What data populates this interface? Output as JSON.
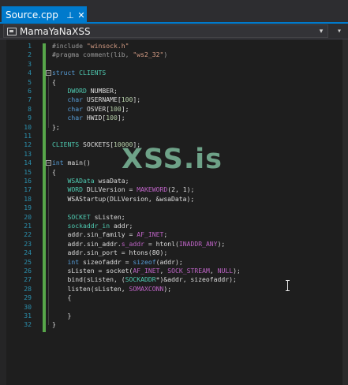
{
  "tab": {
    "title": "Source.cpp",
    "pin": "⊥",
    "close": "✕"
  },
  "nav": {
    "project": "MamaYaNaXSS",
    "dropdown": "▾",
    "split": "▾"
  },
  "watermark": "XSS.is",
  "lines": [
    {
      "n": "1",
      "tokens": [
        [
          "p",
          "#include "
        ],
        [
          "s",
          "\"winsock.h\""
        ]
      ]
    },
    {
      "n": "2",
      "tokens": [
        [
          "p",
          "#pragma comment(lib, "
        ],
        [
          "s",
          "\"ws2_32\""
        ],
        [
          "p",
          ")"
        ]
      ]
    },
    {
      "n": "3",
      "tokens": []
    },
    {
      "n": "4",
      "fold": true,
      "tokens": [
        [
          "k",
          "struct "
        ],
        [
          "t",
          "CLIENTS"
        ]
      ]
    },
    {
      "n": "5",
      "tokens": [
        [
          "d",
          "{"
        ]
      ]
    },
    {
      "n": "6",
      "tokens": [
        [
          "d",
          "    "
        ],
        [
          "t",
          "DWORD"
        ],
        [
          "d",
          " NUMBER;"
        ]
      ]
    },
    {
      "n": "7",
      "tokens": [
        [
          "d",
          "    "
        ],
        [
          "k",
          "char"
        ],
        [
          "d",
          " USERNAME["
        ],
        [
          "n",
          "100"
        ],
        [
          "d",
          "];"
        ]
      ]
    },
    {
      "n": "8",
      "tokens": [
        [
          "d",
          "    "
        ],
        [
          "k",
          "char"
        ],
        [
          "d",
          " OSVER["
        ],
        [
          "n",
          "100"
        ],
        [
          "d",
          "];"
        ]
      ]
    },
    {
      "n": "9",
      "tokens": [
        [
          "d",
          "    "
        ],
        [
          "k",
          "char"
        ],
        [
          "d",
          " HWID["
        ],
        [
          "n",
          "100"
        ],
        [
          "d",
          "];"
        ]
      ]
    },
    {
      "n": "10",
      "tokens": [
        [
          "d",
          "};"
        ]
      ]
    },
    {
      "n": "11",
      "tokens": []
    },
    {
      "n": "12",
      "tokens": [
        [
          "t",
          "CLIENTS"
        ],
        [
          "d",
          " SOCKETS["
        ],
        [
          "n",
          "10000"
        ],
        [
          "d",
          "];"
        ]
      ]
    },
    {
      "n": "13",
      "tokens": []
    },
    {
      "n": "14",
      "fold": true,
      "tokens": [
        [
          "k",
          "int"
        ],
        [
          "d",
          " main()"
        ]
      ]
    },
    {
      "n": "15",
      "tokens": [
        [
          "d",
          "{"
        ]
      ]
    },
    {
      "n": "16",
      "tokens": [
        [
          "d",
          "    "
        ],
        [
          "t",
          "WSAData"
        ],
        [
          "d",
          " wsaData;"
        ]
      ]
    },
    {
      "n": "17",
      "tokens": [
        [
          "d",
          "    "
        ],
        [
          "t",
          "WORD"
        ],
        [
          "d",
          " DLLVersion = "
        ],
        [
          "m",
          "MAKEWORD"
        ],
        [
          "d",
          "(2, 1);"
        ]
      ]
    },
    {
      "n": "18",
      "tokens": [
        [
          "d",
          "    WSAStartup(DLLVersion, &wsaData);"
        ]
      ]
    },
    {
      "n": "19",
      "tokens": []
    },
    {
      "n": "20",
      "tokens": [
        [
          "d",
          "    "
        ],
        [
          "t",
          "SOCKET"
        ],
        [
          "d",
          " sListen;"
        ]
      ]
    },
    {
      "n": "21",
      "tokens": [
        [
          "d",
          "    "
        ],
        [
          "t",
          "sockaddr_in"
        ],
        [
          "d",
          " addr;"
        ]
      ]
    },
    {
      "n": "22",
      "tokens": [
        [
          "d",
          "    addr.sin_family = "
        ],
        [
          "m",
          "AF_INET"
        ],
        [
          "d",
          ";"
        ]
      ]
    },
    {
      "n": "23",
      "tokens": [
        [
          "d",
          "    addr.sin_addr."
        ],
        [
          "m",
          "s_addr"
        ],
        [
          "d",
          " = htonl("
        ],
        [
          "m",
          "INADDR_ANY"
        ],
        [
          "d",
          ");"
        ]
      ]
    },
    {
      "n": "24",
      "tokens": [
        [
          "d",
          "    addr.sin_port = htons(80);"
        ]
      ]
    },
    {
      "n": "25",
      "tokens": [
        [
          "d",
          "    "
        ],
        [
          "k",
          "int"
        ],
        [
          "d",
          " sizeofaddr = "
        ],
        [
          "k",
          "sizeof"
        ],
        [
          "d",
          "(addr);"
        ]
      ]
    },
    {
      "n": "26",
      "tokens": [
        [
          "d",
          "    sListen = socket("
        ],
        [
          "m",
          "AF_INET"
        ],
        [
          "d",
          ", "
        ],
        [
          "m",
          "SOCK_STREAM"
        ],
        [
          "d",
          ", "
        ],
        [
          "m",
          "NULL"
        ],
        [
          "d",
          ");"
        ]
      ]
    },
    {
      "n": "27",
      "tokens": [
        [
          "d",
          "    bind(sListen, ("
        ],
        [
          "t",
          "SOCKADDR"
        ],
        [
          "d",
          "*)&addr, sizeofaddr);"
        ]
      ]
    },
    {
      "n": "28",
      "tokens": [
        [
          "d",
          "    listen(sListen, "
        ],
        [
          "m",
          "SOMAXCONN"
        ],
        [
          "d",
          ");"
        ]
      ]
    },
    {
      "n": "29",
      "tokens": [
        [
          "d",
          "    {"
        ]
      ]
    },
    {
      "n": "30",
      "tokens": []
    },
    {
      "n": "31",
      "tokens": [
        [
          "d",
          "    }"
        ]
      ]
    },
    {
      "n": "32",
      "tokens": [
        [
          "d",
          "}"
        ]
      ]
    }
  ]
}
